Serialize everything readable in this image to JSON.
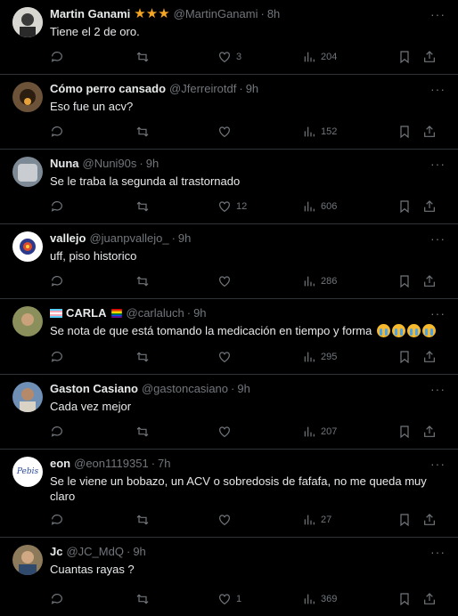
{
  "replies": [
    {
      "name": "Martin Ganami",
      "badge": "★★★",
      "handle": "@MartinGanami",
      "sep": "·",
      "time": "8h",
      "text": "Tiene el 2 de oro.",
      "likes": "3",
      "views": "204",
      "avatar_color": "#c9c7c2"
    },
    {
      "name": "Cómo perro cansado",
      "handle": "@Jferreirotdf",
      "sep": "·",
      "time": "9h",
      "text": "Eso fue un acv?",
      "likes": "",
      "views": "152",
      "avatar_color": "#6b5238"
    },
    {
      "name": "Nuna",
      "handle": "@Nuni90s",
      "sep": "·",
      "time": "9h",
      "text": "Se le traba la segunda al trastornado",
      "likes": "12",
      "views": "606",
      "avatar_color": "#7d8a96"
    },
    {
      "name": "vallejo",
      "handle": "@juanpvallejo_",
      "sep": "·",
      "time": "9h",
      "text": "uff, piso historico",
      "likes": "",
      "views": "286",
      "avatar_color": "#ffffff"
    },
    {
      "name": "CARLA",
      "handle": "@carlaluch",
      "sep": "·",
      "time": "9h",
      "text": "Se nota de que está tomando la medicación en tiempo y forma",
      "likes": "",
      "views": "295",
      "avatar_color": "#8a8f5b"
    },
    {
      "name": "Gaston Casiano",
      "handle": "@gastoncasiano",
      "sep": "·",
      "time": "9h",
      "text": "Cada vez mejor",
      "likes": "",
      "views": "207",
      "avatar_color": "#6f8fb5"
    },
    {
      "name": "eon",
      "handle": "@eon1119351",
      "sep": "·",
      "time": "7h",
      "text": "Se le viene un bobazo, un ACV o sobredosis de fafafa, no me queda muy claro",
      "likes": "",
      "views": "27",
      "avatar_color": "#ffffff",
      "avatar_text": "Pebis"
    },
    {
      "name": "Jc",
      "handle": "@JC_MdQ",
      "sep": "·",
      "time": "9h",
      "text": "Cuantas rayas ?",
      "likes": "1",
      "views": "369",
      "avatar_color": "#8c7a5a"
    }
  ],
  "more_label": "···"
}
